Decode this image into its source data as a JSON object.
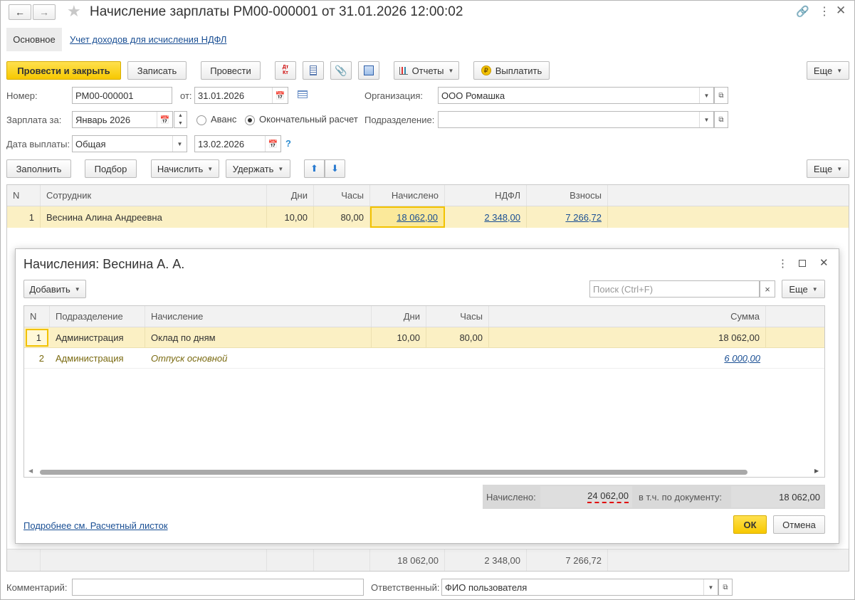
{
  "window": {
    "title": "Начисление зарплаты РМ00-000001 от 31.01.2026 12:00:02"
  },
  "tabs": {
    "main": "Основное",
    "ndfl": "Учет доходов для исчисления НДФЛ"
  },
  "toolbar": {
    "post_close": "Провести и закрыть",
    "save": "Записать",
    "post": "Провести",
    "reports": "Отчеты",
    "pay": "Выплатить",
    "more": "Еще",
    "dt_kt": "Дт Кт"
  },
  "form": {
    "number_label": "Номер:",
    "number": "РМ00-000001",
    "date_label": "от:",
    "date": "31.01.2026",
    "org_label": "Организация:",
    "org": "ООО Ромашка",
    "salary_label": "Зарплата за:",
    "salary_month": "Январь 2026",
    "advance": "Аванс",
    "final": "Окончательный расчет",
    "dept_label": "Подразделение:",
    "dept": "",
    "paydate_label": "Дата выплаты:",
    "paydate_type": "Общая",
    "paydate": "13.02.2026",
    "help": "?"
  },
  "actions": {
    "fill": "Заполнить",
    "select": "Подбор",
    "accrue": "Начислить",
    "withhold": "Удержать",
    "more": "Еще"
  },
  "main_table": {
    "headers": {
      "n": "N",
      "employee": "Сотрудник",
      "days": "Дни",
      "hours": "Часы",
      "accrued": "Начислено",
      "ndfl": "НДФЛ",
      "contrib": "Взносы"
    },
    "rows": [
      {
        "n": "1",
        "employee": "Веснина Алина Андреевна",
        "days": "10,00",
        "hours": "80,00",
        "accrued": "18 062,00",
        "ndfl": "2 348,00",
        "contrib": "7 266,72"
      }
    ],
    "totals": {
      "accrued": "18 062,00",
      "ndfl": "2 348,00",
      "contrib": "7 266,72"
    }
  },
  "dialog": {
    "title": "Начисления: Веснина А. А.",
    "add": "Добавить",
    "search_placeholder": "Поиск (Ctrl+F)",
    "clear": "×",
    "more": "Еще",
    "headers": {
      "n": "N",
      "dept": "Подразделение",
      "accrual": "Начисление",
      "days": "Дни",
      "hours": "Часы",
      "sum": "Сумма"
    },
    "rows": [
      {
        "n": "1",
        "dept": "Администрация",
        "accrual": "Оклад по дням",
        "days": "10,00",
        "hours": "80,00",
        "sum": "18 062,00"
      },
      {
        "n": "2",
        "dept": "Администрация",
        "accrual": "Отпуск основной",
        "days": "",
        "hours": "",
        "sum": "6 000,00"
      }
    ],
    "accrued_label": "Начислено:",
    "accrued": "24 062,00",
    "doc_label": "в т.ч. по документу:",
    "doc": "18 062,00",
    "link": "Подробнее см. Расчетный листок",
    "ok": "ОК",
    "cancel": "Отмена"
  },
  "footer": {
    "comment_label": "Комментарий:",
    "comment": "",
    "resp_label": "Ответственный:",
    "resp": "ФИО пользователя"
  },
  "colors": {
    "accent_yellow": "#f7c800",
    "row_highlight": "#fbf0c4",
    "link": "#1a4f94"
  }
}
